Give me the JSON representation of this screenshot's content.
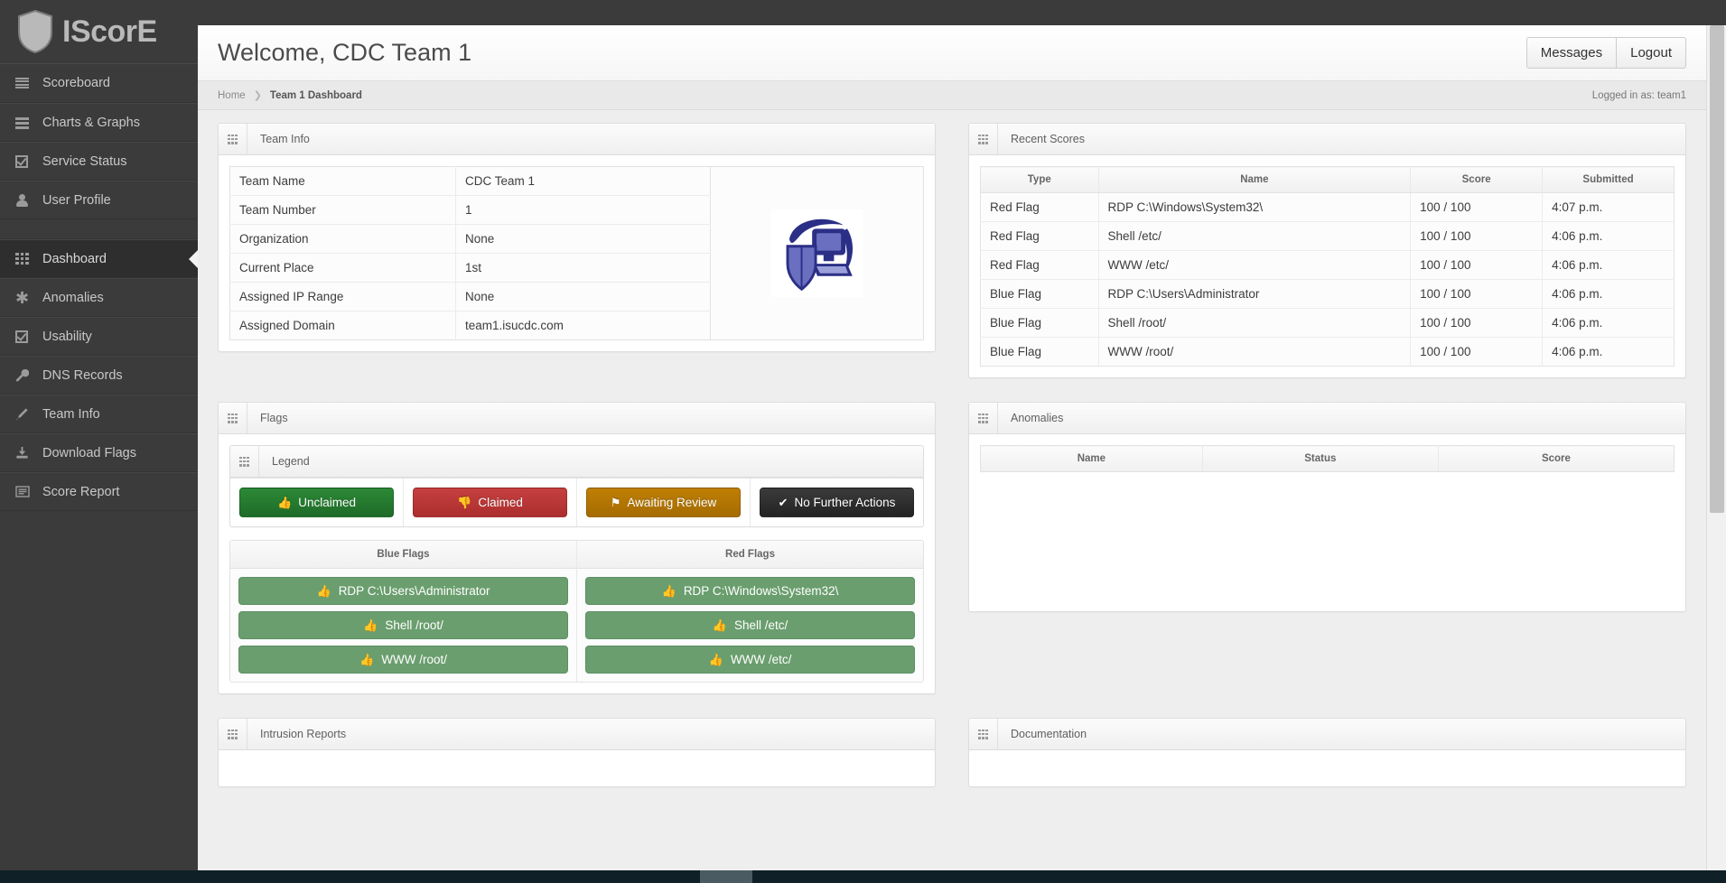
{
  "brand": {
    "name": "IScorE",
    "icon": "shield-icon"
  },
  "sidebar": {
    "items": [
      {
        "label": "Scoreboard",
        "icon": "list-icon",
        "active": false
      },
      {
        "label": "Charts & Graphs",
        "icon": "list-alt-icon",
        "active": false
      },
      {
        "label": "Service Status",
        "icon": "check-square-icon",
        "active": false
      },
      {
        "label": "User Profile",
        "icon": "user-icon",
        "active": false
      }
    ],
    "items2": [
      {
        "label": "Dashboard",
        "icon": "grid-icon",
        "active": true
      },
      {
        "label": "Anomalies",
        "icon": "asterisk-icon",
        "active": false
      },
      {
        "label": "Usability",
        "icon": "check-square-icon",
        "active": false
      },
      {
        "label": "DNS Records",
        "icon": "wrench-icon",
        "active": false
      },
      {
        "label": "Team Info",
        "icon": "pencil-icon",
        "active": false
      },
      {
        "label": "Download Flags",
        "icon": "download-icon",
        "active": false
      },
      {
        "label": "Score Report",
        "icon": "report-icon",
        "active": false
      }
    ]
  },
  "header": {
    "title": "Welcome, CDC Team 1",
    "messages_label": "Messages",
    "logout_label": "Logout"
  },
  "breadcrumb": {
    "home": "Home",
    "separator": "❯",
    "current": "Team 1 Dashboard",
    "logged_in": "Logged in as: team1"
  },
  "panels": {
    "team_info": {
      "title": "Team Info",
      "rows": [
        {
          "label": "Team Name",
          "value": "CDC Team 1"
        },
        {
          "label": "Team Number",
          "value": "1"
        },
        {
          "label": "Organization",
          "value": "None"
        },
        {
          "label": "Current Place",
          "value": "1st"
        },
        {
          "label": "Assigned IP Range",
          "value": "None"
        },
        {
          "label": "Assigned Domain",
          "value": "team1.isucdc.com"
        }
      ],
      "logo_icon": "team-logo-icon"
    },
    "recent_scores": {
      "title": "Recent Scores",
      "columns": [
        "Type",
        "Name",
        "Score",
        "Submitted"
      ],
      "rows": [
        [
          "Red Flag",
          "RDP C:\\Windows\\System32\\",
          "100 / 100",
          "4:07 p.m."
        ],
        [
          "Red Flag",
          "Shell /etc/",
          "100 / 100",
          "4:06 p.m."
        ],
        [
          "Red Flag",
          "WWW /etc/",
          "100 / 100",
          "4:06 p.m."
        ],
        [
          "Blue Flag",
          "RDP C:\\Users\\Administrator",
          "100 / 100",
          "4:06 p.m."
        ],
        [
          "Blue Flag",
          "Shell /root/",
          "100 / 100",
          "4:06 p.m."
        ],
        [
          "Blue Flag",
          "WWW /root/",
          "100 / 100",
          "4:06 p.m."
        ]
      ]
    },
    "flags": {
      "title": "Flags",
      "legend": {
        "title": "Legend",
        "buttons": [
          {
            "label": "Unclaimed",
            "color": "#2b8a36",
            "style": "green",
            "icon": "thumbs-up-icon",
            "glyph": "👍"
          },
          {
            "label": "Claimed",
            "color": "#c64040",
            "style": "red",
            "icon": "thumbs-down-icon",
            "glyph": "👎"
          },
          {
            "label": "Awaiting Review",
            "color": "#c07f04",
            "style": "orange",
            "icon": "flag-icon",
            "glyph": "⚑"
          },
          {
            "label": "No Further Actions",
            "color": "#2b2b2b",
            "style": "dark",
            "icon": "check-icon",
            "glyph": "✔"
          }
        ]
      },
      "columns": [
        "Blue Flags",
        "Red Flags"
      ],
      "blue_flags": [
        {
          "label": "RDP C:\\Users\\Administrator",
          "icon": "thumbs-up-icon",
          "glyph": "👍"
        },
        {
          "label": "Shell /root/",
          "icon": "thumbs-up-icon",
          "glyph": "👍"
        },
        {
          "label": "WWW /root/",
          "icon": "thumbs-up-icon",
          "glyph": "👍"
        }
      ],
      "red_flags": [
        {
          "label": "RDP C:\\Windows\\System32\\",
          "icon": "thumbs-up-icon",
          "glyph": "👍"
        },
        {
          "label": "Shell /etc/",
          "icon": "thumbs-up-icon",
          "glyph": "👍"
        },
        {
          "label": "WWW /etc/",
          "icon": "thumbs-up-icon",
          "glyph": "👍"
        }
      ],
      "flag_color": "#6a9e6e"
    },
    "anomalies": {
      "title": "Anomalies",
      "columns": [
        "Name",
        "Status",
        "Score"
      ],
      "rows": []
    },
    "intrusion_reports": {
      "title": "Intrusion Reports"
    },
    "documentation": {
      "title": "Documentation"
    }
  },
  "colors": {
    "sidebar_bg": "#3b3b3b",
    "sidebar_active": "#2e2e2e",
    "page_bg": "#eeeeee",
    "panel_border": "#dddddd"
  }
}
